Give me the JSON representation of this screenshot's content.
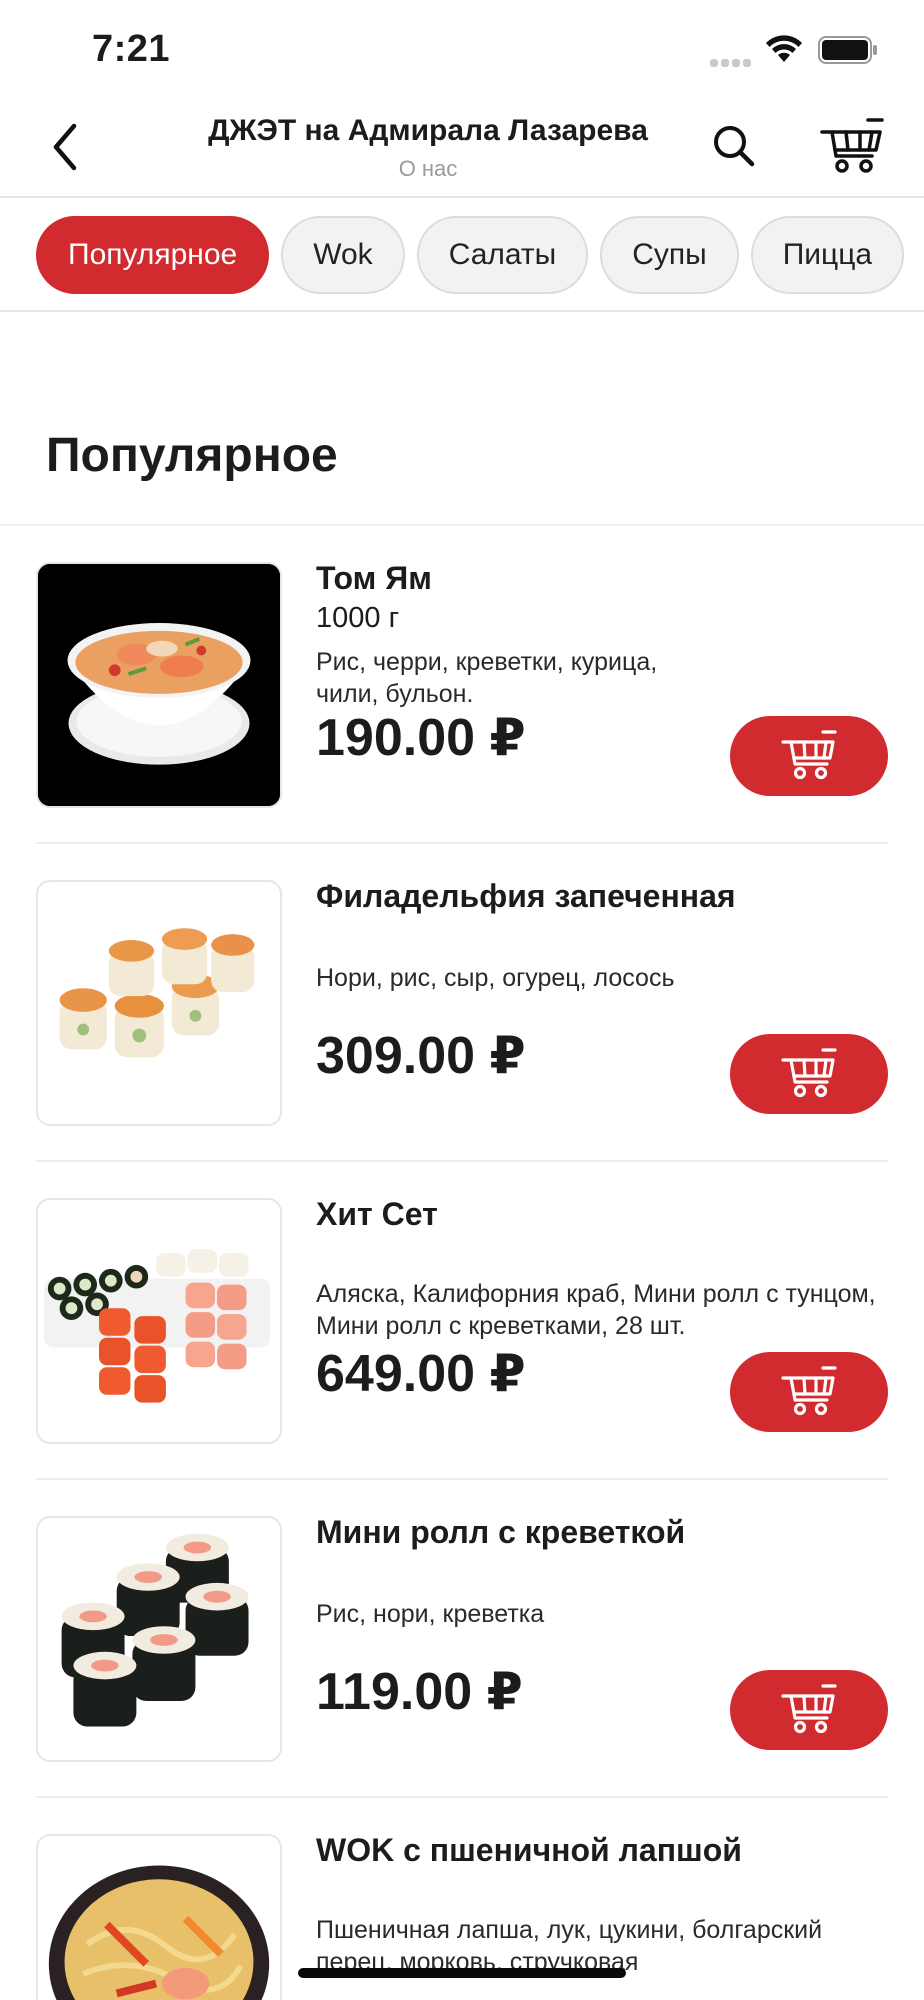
{
  "status_bar": {
    "time": "7:21"
  },
  "header": {
    "title": "ДЖЭТ на Адмирала Лазарева",
    "subtitle": "О нас",
    "back_icon": "chevron-left-icon",
    "search_icon": "search-icon",
    "cart_icon": "cart-icon"
  },
  "tabs": [
    {
      "label": "Популярное",
      "active": true
    },
    {
      "label": "Wok",
      "active": false
    },
    {
      "label": "Салаты",
      "active": false
    },
    {
      "label": "Супы",
      "active": false
    },
    {
      "label": "Пицца",
      "active": false
    }
  ],
  "section": {
    "title": "Популярное"
  },
  "products": [
    {
      "name": "Том Ям",
      "weight": "1000 г",
      "description": "Рис, черри, креветки, курица,\nчили, бульон.",
      "price": "190.00 ₽",
      "image_icon": "tom-yum-soup-image"
    },
    {
      "name": "Филадельфия запеченная",
      "weight": "",
      "description": "Нори, рис, сыр, огурец, лосось",
      "price": "309.00 ₽",
      "image_icon": "baked-roll-image"
    },
    {
      "name": "Хит Сет",
      "weight": "",
      "description": "Аляска, Калифорния краб, Мини ролл с тунцом, Мини ролл с креветками, 28 шт.",
      "price": "649.00 ₽",
      "image_icon": "sushi-set-image"
    },
    {
      "name": "Мини ролл с креветкой",
      "weight": "",
      "description": "Рис, нори, креветка",
      "price": "119.00 ₽",
      "image_icon": "shrimp-roll-image"
    },
    {
      "name": "WOK с пшеничной лапшой",
      "weight": "",
      "description": "Пшеничная лапша, лук, цукини, болгарский перец, морковь, стручковая",
      "price": "",
      "image_icon": "wok-noodles-image"
    }
  ],
  "colors": {
    "accent": "#d22b2f",
    "text": "#1c1c1c",
    "muted": "#9a9a9a",
    "chip_bg": "#f2f2f2"
  }
}
